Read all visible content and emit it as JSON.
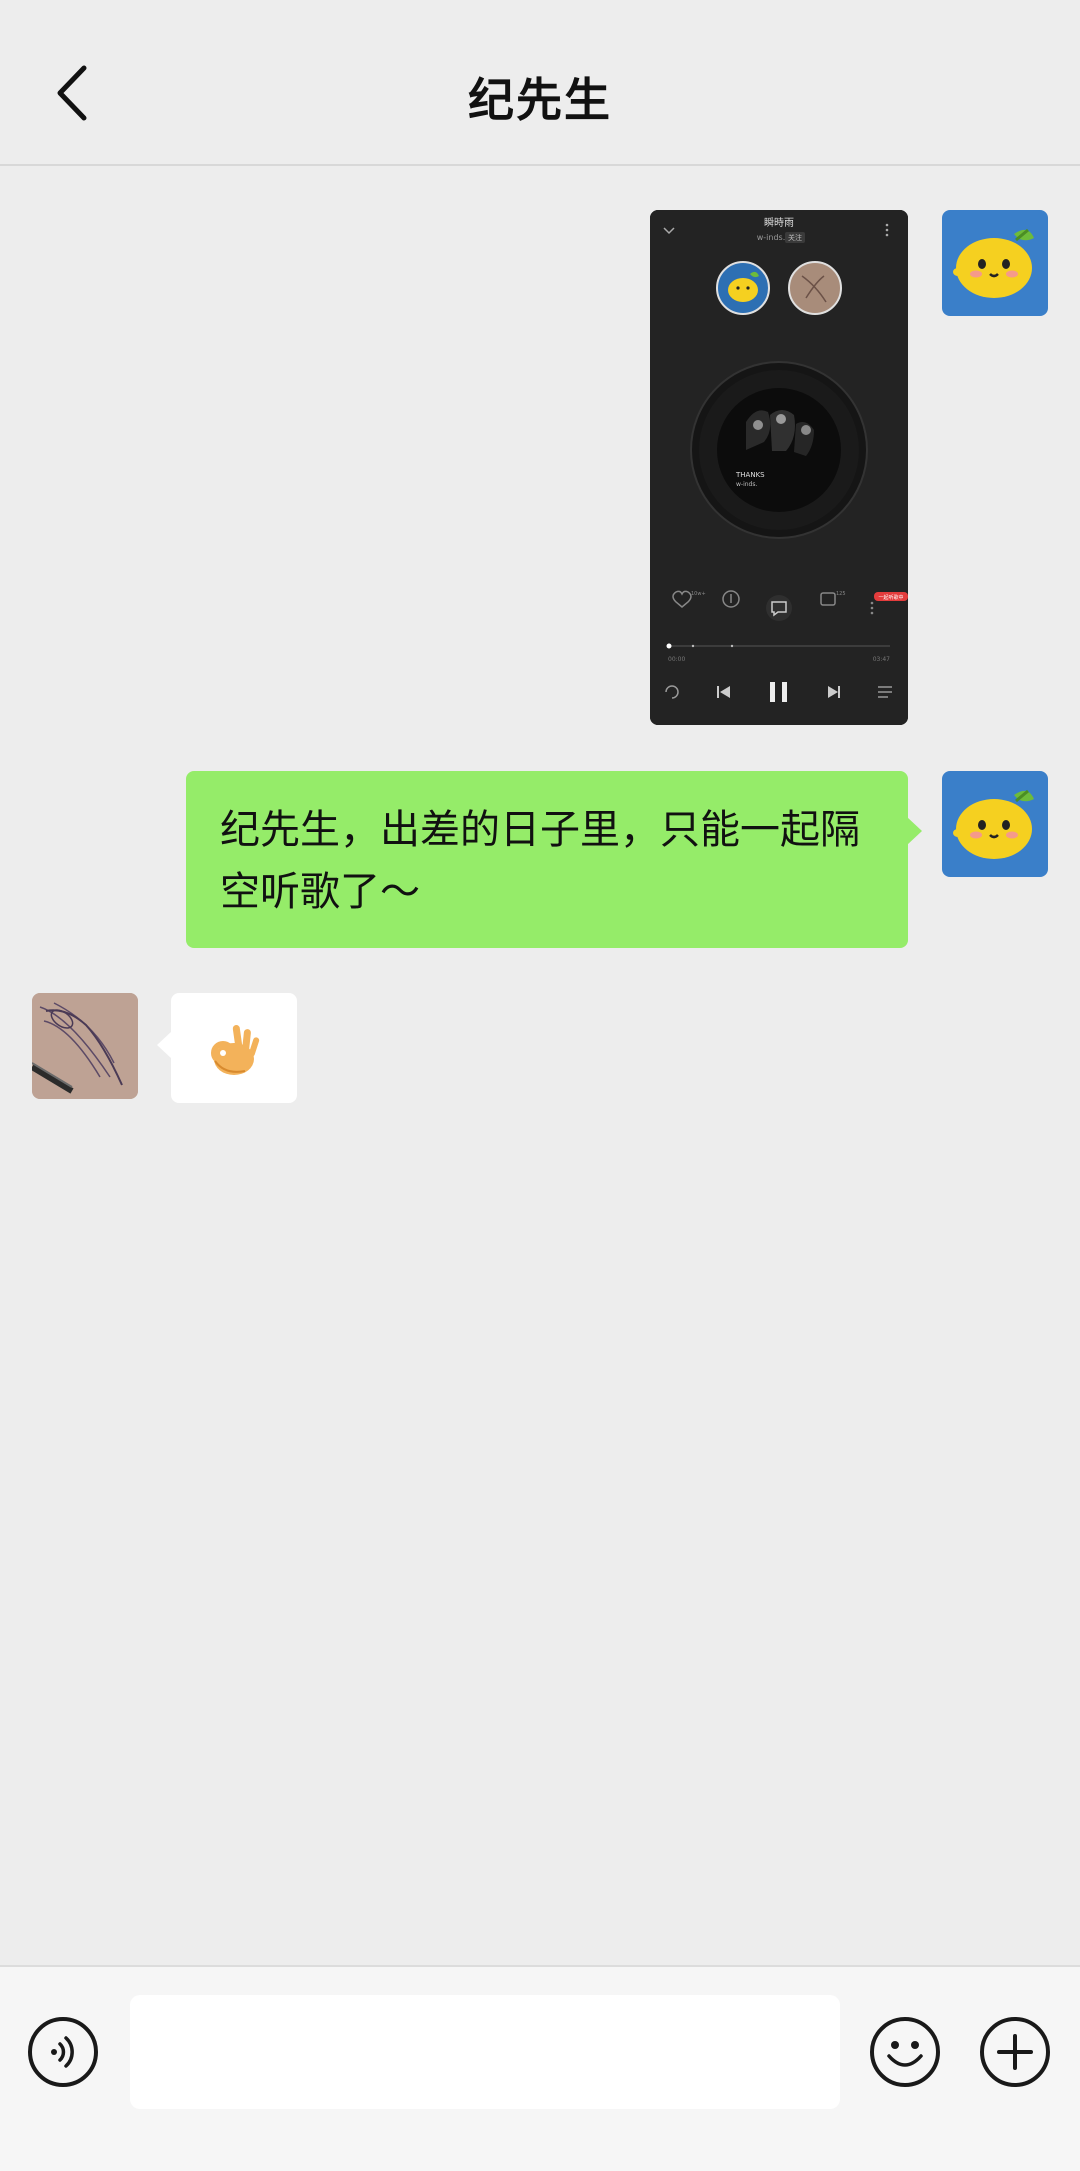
{
  "header": {
    "title": "纪先生"
  },
  "messages": [
    {
      "side": "right",
      "type": "image",
      "music_screenshot": {
        "song_title": "瞬時雨",
        "artist": "w-inds.",
        "badge": "关注",
        "album_text_1": "THANKS",
        "album_text_2": "w-inds.",
        "like_count": "10w+",
        "comment_count": "125",
        "red_tag": "一起听歌中",
        "time_elapsed": "00:00",
        "time_total": "03:47",
        "progress": 0.0
      }
    },
    {
      "side": "right",
      "type": "text",
      "text": "纪先生，出差的日子里，只能一起隔空听歌了～"
    },
    {
      "side": "left",
      "type": "emoji",
      "emoji": "ok-hand"
    }
  ],
  "input": {
    "value": ""
  },
  "icons": {
    "back": "chevron-left-icon",
    "voice": "voice-icon",
    "emoji": "smiley-icon",
    "plus": "plus-icon"
  },
  "colors": {
    "background": "#ededed",
    "bubble_sent": "#95ec69",
    "bubble_received": "#ffffff",
    "avatar_bg": "#3a7fc9",
    "lemon": "#f5d020"
  }
}
